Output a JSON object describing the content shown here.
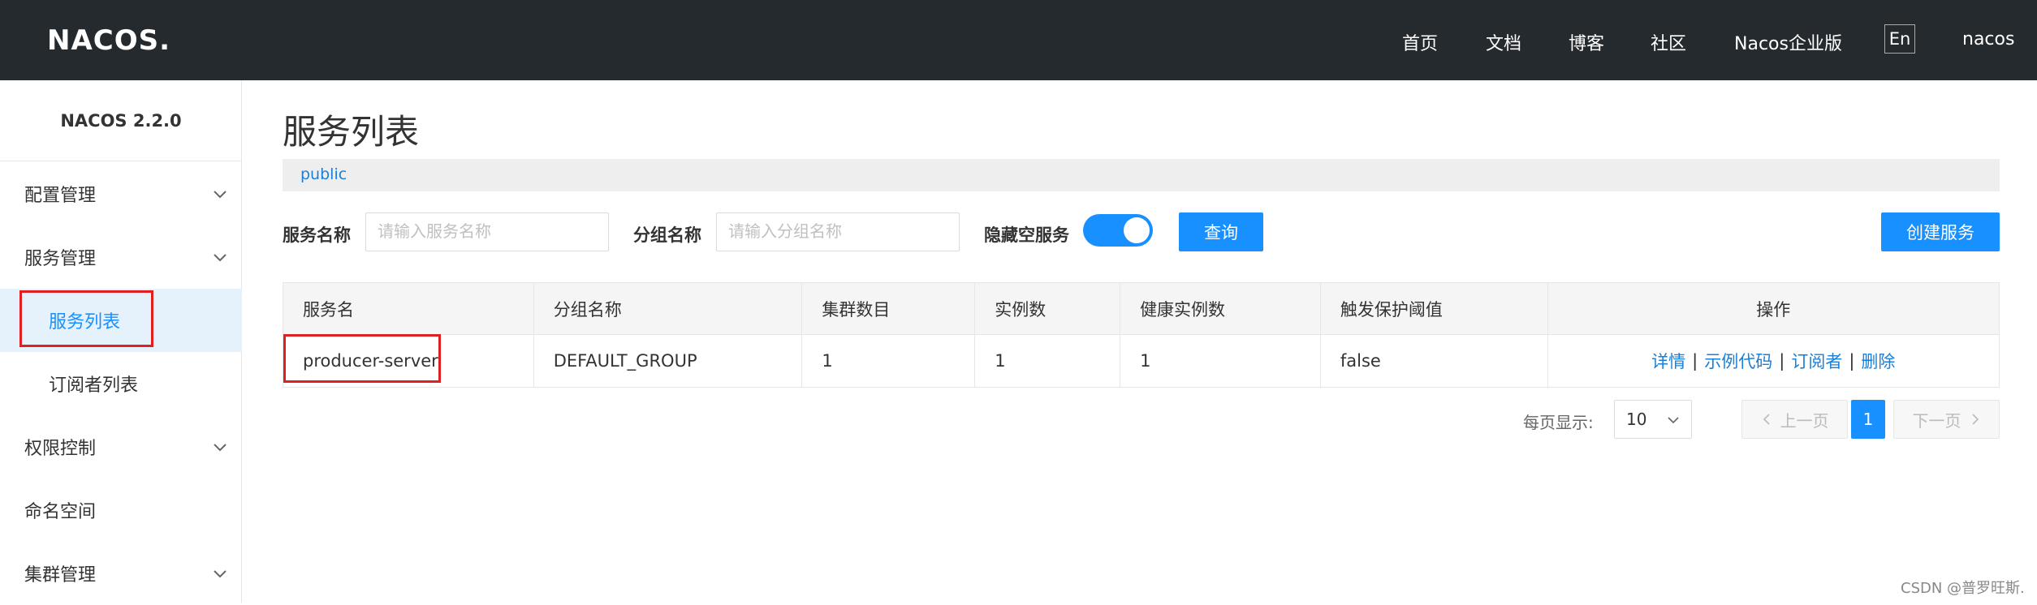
{
  "topbar": {
    "logo": "NACOS.",
    "nav": {
      "homepage": "首页",
      "docs": "文档",
      "blog": "博客",
      "community": "社区",
      "enterprise": "Nacos企业版",
      "lang": "En",
      "user": "nacos"
    }
  },
  "sidebar": {
    "title": "NACOS 2.2.0",
    "items": [
      {
        "label": "配置管理",
        "expandable": true
      },
      {
        "label": "服务管理",
        "expandable": true
      },
      {
        "label": "服务列表",
        "active": true
      },
      {
        "label": "订阅者列表"
      },
      {
        "label": "权限控制",
        "expandable": true
      },
      {
        "label": "命名空间"
      },
      {
        "label": "集群管理",
        "expandable": true
      }
    ]
  },
  "main": {
    "title": "服务列表",
    "namespace": "public",
    "filters": {
      "service_name_label": "服务名称",
      "service_name_placeholder": "请输入服务名称",
      "group_name_label": "分组名称",
      "group_name_placeholder": "请输入分组名称",
      "hide_empty_label": "隐藏空服务",
      "query_button": "查询",
      "create_button": "创建服务"
    },
    "table": {
      "headers": [
        "服务名",
        "分组名称",
        "集群数目",
        "实例数",
        "健康实例数",
        "触发保护阈值",
        "操作"
      ],
      "rows": [
        {
          "service": "producer-server",
          "group": "DEFAULT_GROUP",
          "clusters": "1",
          "instances": "1",
          "healthy": "1",
          "protect": "false",
          "ops": [
            "详情",
            "示例代码",
            "订阅者",
            "删除"
          ]
        }
      ]
    },
    "pagination": {
      "per_page_label": "每页显示:",
      "per_page_value": "10",
      "prev": "上一页",
      "current": "1",
      "next": "下一页"
    }
  },
  "watermark": "CSDN @普罗旺斯.",
  "colors": {
    "topbar": "#252a2f",
    "primary": "#1890ff",
    "highlight": "#e02020"
  }
}
